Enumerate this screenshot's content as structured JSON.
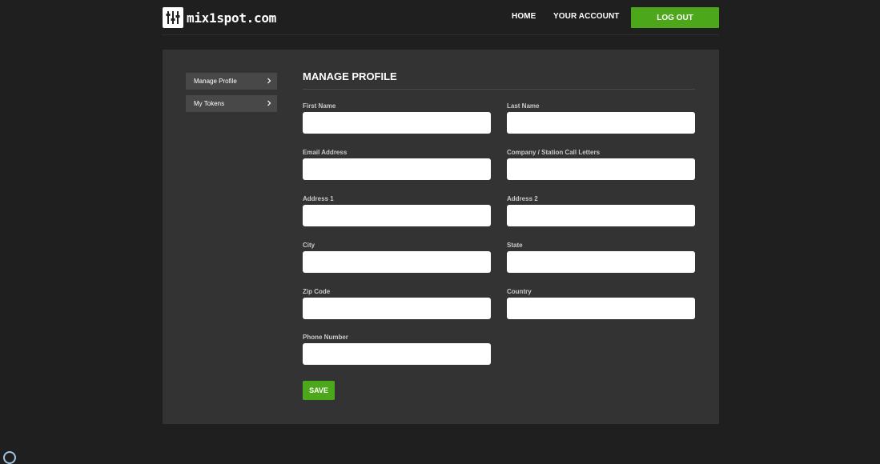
{
  "brand": {
    "name": "mix1spot.com",
    "icon": "mixer-sliders-icon"
  },
  "nav": {
    "home": "HOME",
    "account": "YOUR ACCOUNT",
    "logout": "LOG OUT"
  },
  "sidebar": {
    "items": [
      {
        "label": "Manage Profile",
        "icon": "chevron-right-icon"
      },
      {
        "label": "My Tokens",
        "icon": "chevron-right-icon"
      }
    ]
  },
  "form": {
    "title": "MANAGE PROFILE",
    "fields": [
      {
        "label": "First Name",
        "value": ""
      },
      {
        "label": "Last Name",
        "value": ""
      },
      {
        "label": "Email Address",
        "value": ""
      },
      {
        "label": "Company / Station Call Letters",
        "value": ""
      },
      {
        "label": "Address 1",
        "value": ""
      },
      {
        "label": "Address 2",
        "value": ""
      },
      {
        "label": "City",
        "value": ""
      },
      {
        "label": "State",
        "value": ""
      },
      {
        "label": "Zip Code",
        "value": ""
      },
      {
        "label": "Country",
        "value": ""
      },
      {
        "label": "Phone Number",
        "value": ""
      }
    ],
    "save_label": "SAVE"
  },
  "colors": {
    "accent": "#4da71b",
    "background": "#1f1f1f",
    "panel": "#333333",
    "sidebar_item": "#484848"
  }
}
